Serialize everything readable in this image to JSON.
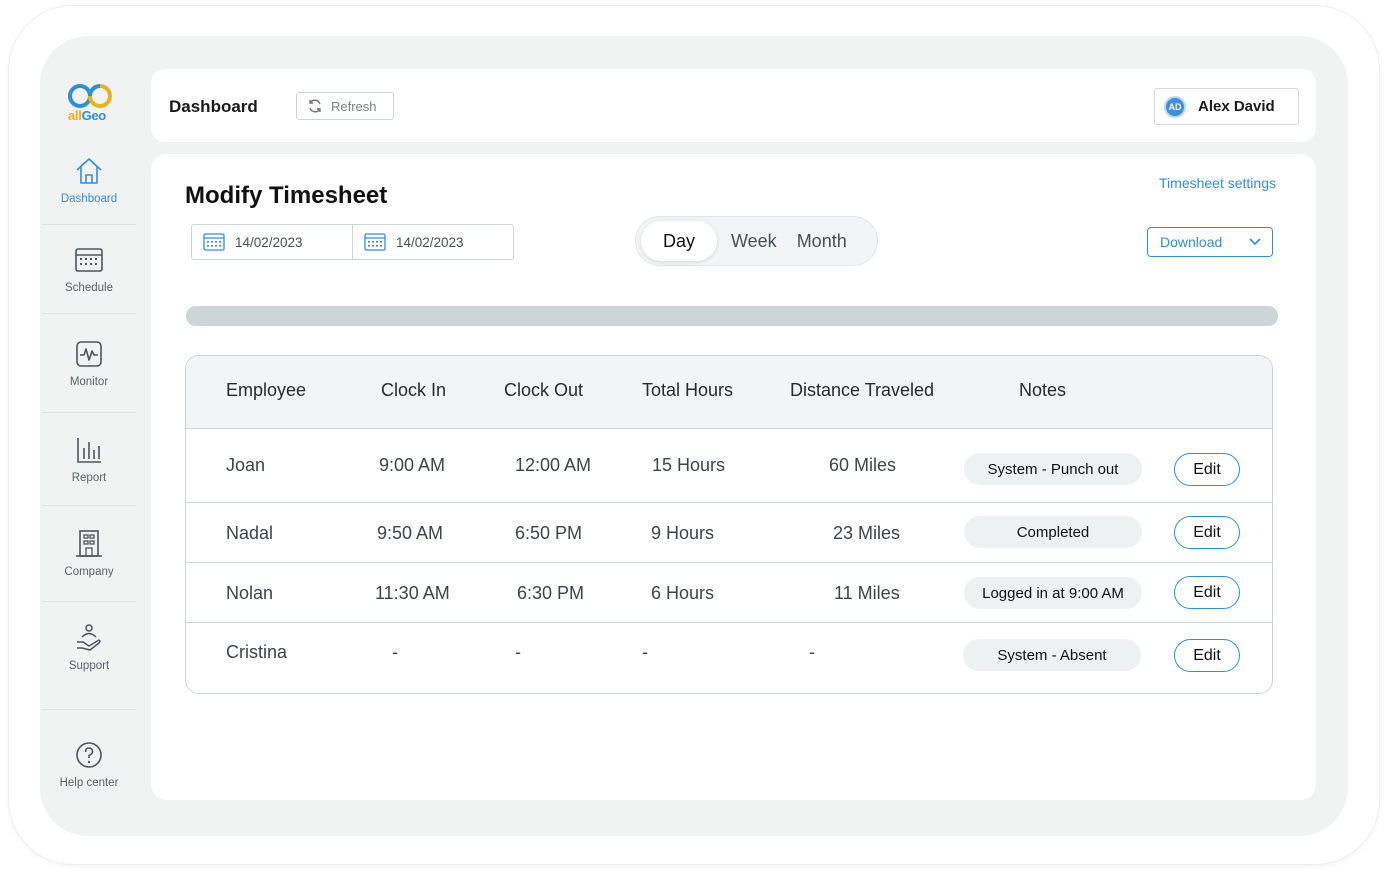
{
  "brand": {
    "logo_text_prefix": "all",
    "logo_text_suffix": "Geo"
  },
  "sidebar": {
    "items": [
      {
        "label": "Dashboard",
        "icon": "home-icon"
      },
      {
        "label": "Schedule",
        "icon": "calendar-icon"
      },
      {
        "label": "Monitor",
        "icon": "monitor-icon"
      },
      {
        "label": "Report",
        "icon": "bar-chart-icon"
      },
      {
        "label": "Company",
        "icon": "building-icon"
      },
      {
        "label": "Support",
        "icon": "support-icon"
      },
      {
        "label": "Help center",
        "icon": "help-icon"
      }
    ]
  },
  "header": {
    "title": "Dashboard",
    "refresh_label": "Refresh",
    "user_initials": "AD",
    "user_name": "Alex David"
  },
  "main": {
    "title": "Modify Timesheet",
    "settings_link": "Timesheet settings",
    "date_from": "14/02/2023",
    "date_to": "14/02/2023",
    "periods": [
      "Day",
      "Week",
      "Month"
    ],
    "active_period": "Day",
    "download_label": "Download"
  },
  "table": {
    "headers": [
      "Employee",
      "Clock In",
      "Clock Out",
      "Total Hours",
      "Distance Traveled",
      "Notes"
    ],
    "rows": [
      {
        "employee": "Joan",
        "clock_in": "9:00 AM",
        "clock_out": "12:00 AM",
        "total_hours": "15 Hours",
        "distance": "60 Miles",
        "note": "System - Punch out",
        "action": "Edit"
      },
      {
        "employee": "Nadal",
        "clock_in": "9:50 AM",
        "clock_out": "6:50 PM",
        "total_hours": "9 Hours",
        "distance": "23 Miles",
        "note": "Completed",
        "action": "Edit"
      },
      {
        "employee": "Nolan",
        "clock_in": "11:30 AM",
        "clock_out": "6:30 PM",
        "total_hours": "6 Hours",
        "distance": "11 Miles",
        "note": "Logged in at 9:00 AM",
        "action": "Edit"
      },
      {
        "employee": "Cristina",
        "clock_in": "-",
        "clock_out": "-",
        "total_hours": "-",
        "distance": "-",
        "note": "System - Absent",
        "action": "Edit"
      }
    ]
  },
  "colors": {
    "accent": "#2f8fd8",
    "logo_yellow": "#e8b21a",
    "progress_track": "#cdd5d9"
  }
}
